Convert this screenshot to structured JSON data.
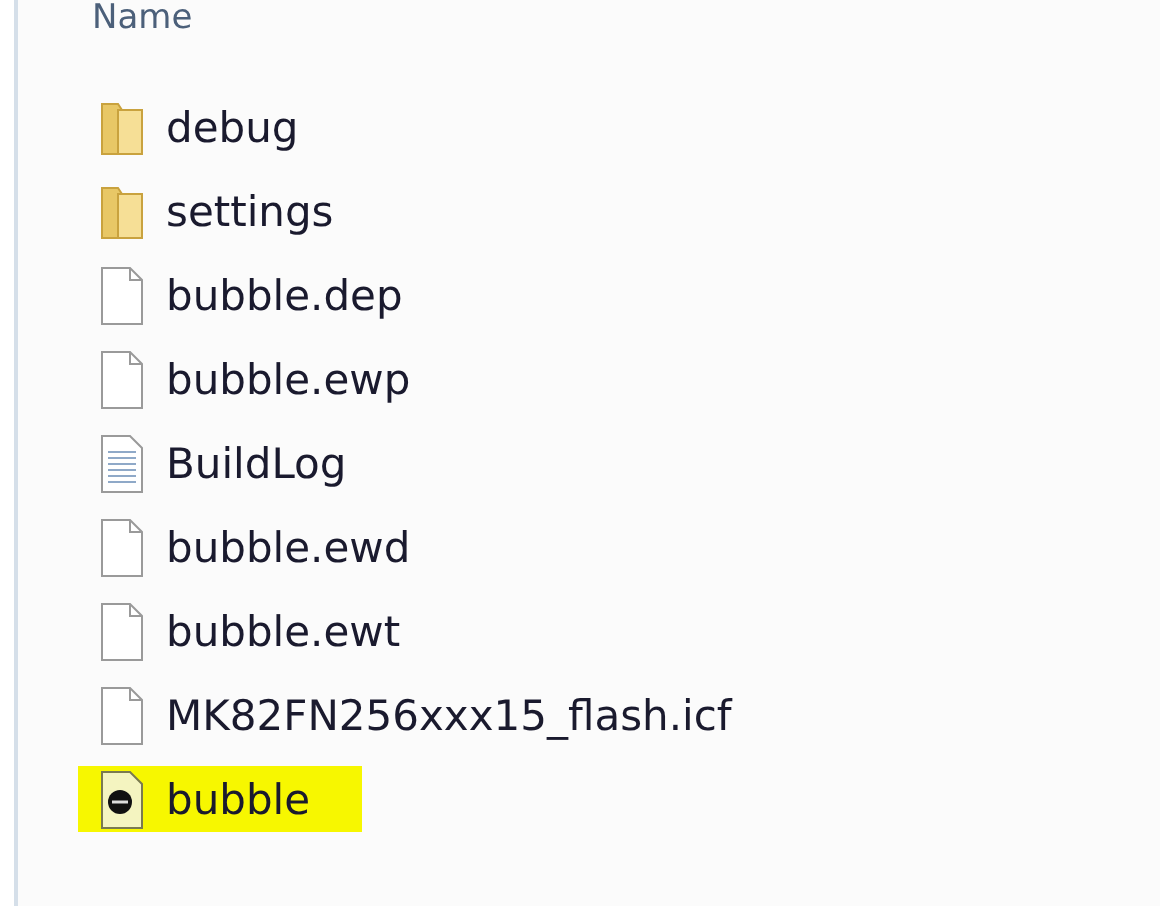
{
  "column_header": "Name",
  "items": [
    {
      "name": "debug",
      "kind": "folder",
      "highlighted": false
    },
    {
      "name": "settings",
      "kind": "folder",
      "highlighted": false
    },
    {
      "name": "bubble.dep",
      "kind": "file",
      "highlighted": false
    },
    {
      "name": "bubble.ewp",
      "kind": "file",
      "highlighted": false
    },
    {
      "name": "BuildLog",
      "kind": "text",
      "highlighted": false
    },
    {
      "name": "bubble.ewd",
      "kind": "file",
      "highlighted": false
    },
    {
      "name": "bubble.ewt",
      "kind": "file",
      "highlighted": false
    },
    {
      "name": "MK82FN256xxx15_flash.icf",
      "kind": "file",
      "highlighted": false
    },
    {
      "name": "bubble",
      "kind": "app",
      "highlighted": true
    }
  ]
}
